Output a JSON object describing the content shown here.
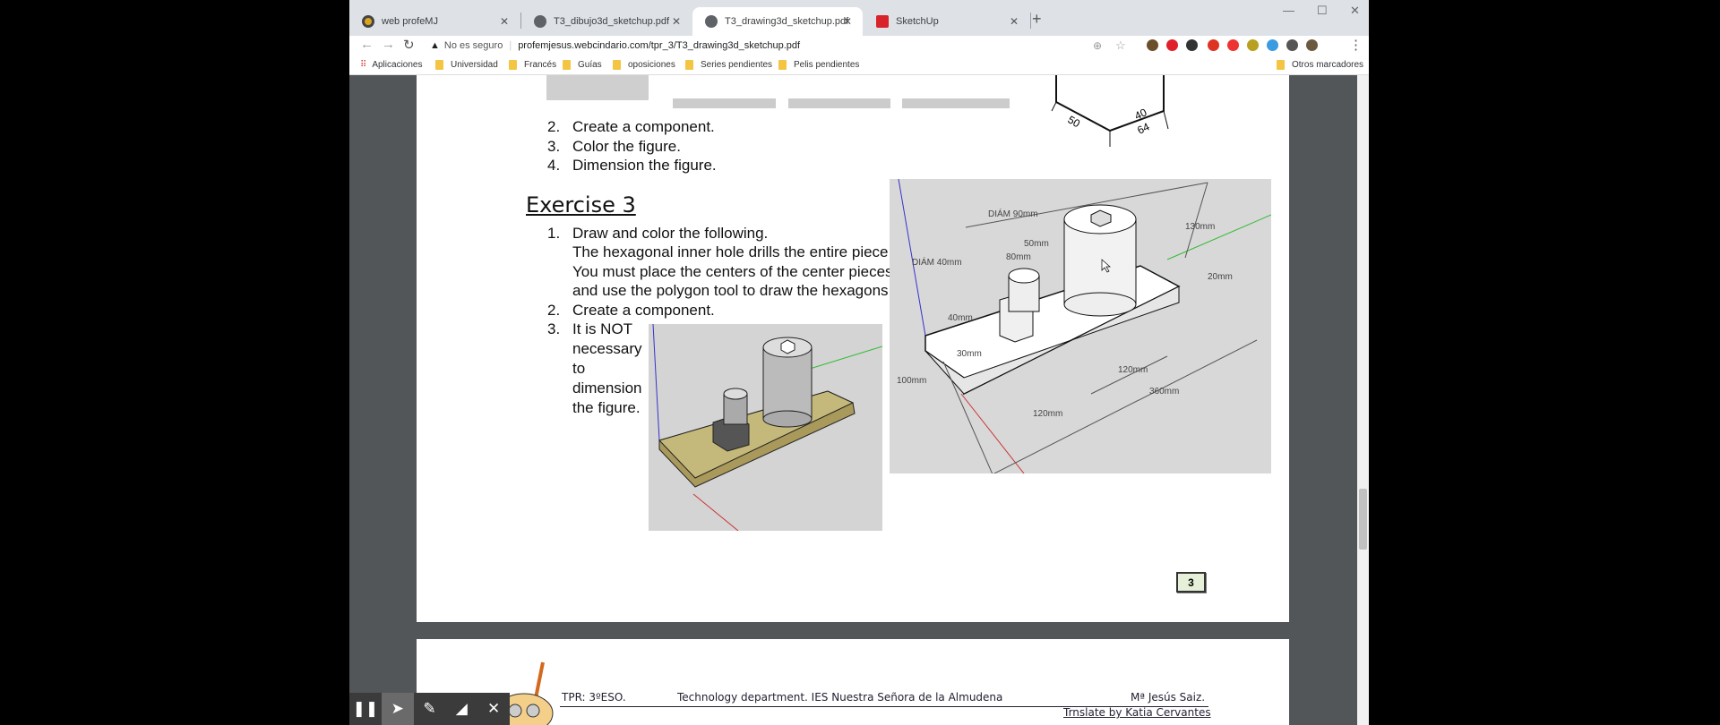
{
  "browser": {
    "tabs": [
      {
        "label": "web profeMJ",
        "icon": "profemj-icon",
        "active": false
      },
      {
        "label": "T3_dibujo3d_sketchup.pdf",
        "icon": "globe-icon",
        "active": false
      },
      {
        "label": "T3_drawing3d_sketchup.pdf",
        "icon": "globe-icon",
        "active": true
      },
      {
        "label": "SketchUp",
        "icon": "sketchup-icon",
        "active": false
      }
    ],
    "security": "No es seguro",
    "url": "profemjesus.webcindario.com/tpr_3/T3_drawing3d_sketchup.pdf",
    "bookmarks": [
      "Aplicaciones",
      "Universidad",
      "Francés",
      "Guías",
      "oposiciones",
      "Series pendientes",
      "Pelis pendientes"
    ],
    "other_bookmarks": "Otros marcadores"
  },
  "pdf": {
    "prev_list": [
      {
        "n": "2.",
        "t": "Create a component."
      },
      {
        "n": "3.",
        "t": "Color the figure."
      },
      {
        "n": "4.",
        "t": "Dimension the figure."
      }
    ],
    "prev_dims": [
      "50",
      "40",
      "64"
    ],
    "exercise_title": "Exercise 3",
    "list": [
      {
        "n": "1.",
        "lines": [
          "Draw and color the following.",
          "The hexagonal inner hole drills the entire piece.",
          "You must place the centers of the center pieces",
          "and use the polygon tool to draw the hexagons."
        ]
      },
      {
        "n": "2.",
        "lines": [
          "Create a component."
        ]
      },
      {
        "n": "3.",
        "lines": [
          "It is NOT",
          "necessary",
          "to",
          "dimension",
          "the figure."
        ]
      }
    ],
    "dims": {
      "d90": "DIÁM 90mm",
      "d40": "DIÁM 40mm",
      "h130": "130mm",
      "w50": "50mm",
      "w80": "80mm",
      "w20": "20mm",
      "w40": "40mm",
      "w30": "30mm",
      "h100": "100mm",
      "l120a": "120mm",
      "l120b": "120mm",
      "l360": "360mm"
    },
    "page_number": "3",
    "footer": {
      "course": "TPR: 3ºESO.",
      "dept": "Technology department. IES Nuestra Señora de la Almudena",
      "author": "Mª Jesús Saiz.",
      "translator": "Trnslate by Katia Cervantes"
    }
  },
  "annotation_toolbar": [
    "pause-icon",
    "pointer-icon",
    "pen-icon",
    "highlighter-icon",
    "close-icon"
  ]
}
